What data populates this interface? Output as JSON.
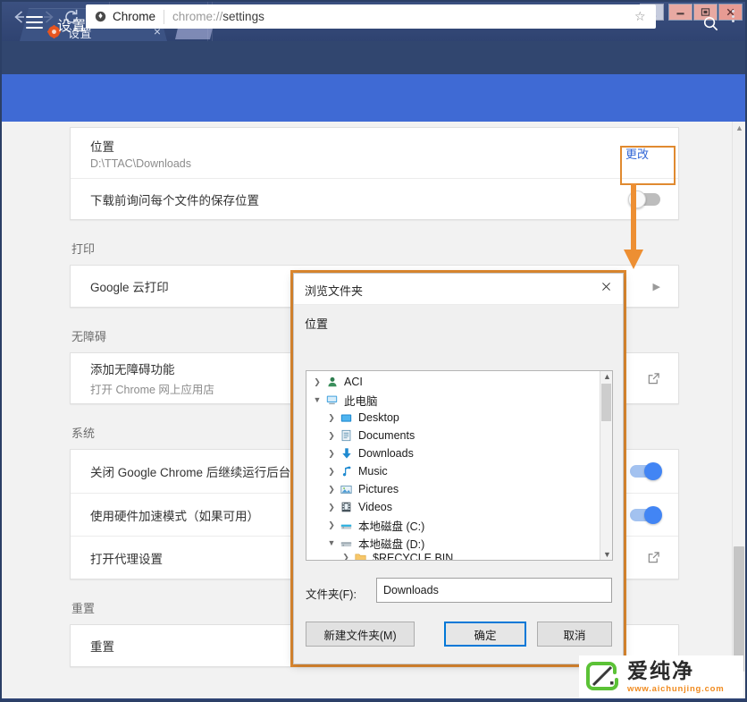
{
  "window": {
    "tab": {
      "title": "设置",
      "icon": "gear-icon",
      "close": "×"
    },
    "controls": {
      "person": "👤",
      "minimize": "—",
      "maximize": "❐",
      "close": "✕"
    }
  },
  "toolbar": {
    "back": "back-arrow-icon",
    "forward": "forward-arrow-icon",
    "reload": "reload-icon",
    "brand": "Chrome",
    "url_prefix": "chrome://",
    "url_page": "settings",
    "star": "☆",
    "menu": "kebab-menu-icon"
  },
  "settings_header": {
    "menu": "hamburger-icon",
    "title": "设置",
    "search": "search-icon"
  },
  "settings": {
    "download_card": {
      "location_label": "位置",
      "location_value": "D:\\TTAC\\Downloads",
      "change_button": "更改",
      "ask_label": "下载前询问每个文件的保存位置",
      "ask_toggle": "off"
    },
    "sections": [
      {
        "label": "打印",
        "rows": [
          {
            "main": "Google 云打印",
            "sub": "",
            "control": "chevron",
            "value": ""
          }
        ]
      },
      {
        "label": "无障碍",
        "rows": [
          {
            "main": "添加无障碍功能",
            "sub": "打开 Chrome 网上应用店",
            "control": "external-link",
            "value": ""
          }
        ]
      },
      {
        "label": "系统",
        "rows": [
          {
            "main": "关闭 Google Chrome 后继续运行后台应",
            "sub": "",
            "control": "toggle",
            "value": "on"
          },
          {
            "main": "使用硬件加速模式（如果可用）",
            "sub": "",
            "control": "toggle",
            "value": "on"
          },
          {
            "main": "打开代理设置",
            "sub": "",
            "control": "external-link",
            "value": ""
          }
        ]
      },
      {
        "label": "重置",
        "rows": [
          {
            "main": "重置",
            "sub": "",
            "control": "none",
            "value": ""
          }
        ]
      }
    ]
  },
  "dialog": {
    "title": "浏览文件夹",
    "close": "✕",
    "location_label": "位置",
    "tree": [
      {
        "label": "ACI",
        "icon": "user-icon",
        "expander": "collapsed",
        "indent": 0
      },
      {
        "label": "此电脑",
        "icon": "computer-icon",
        "expander": "expanded",
        "indent": 0
      },
      {
        "label": "Desktop",
        "icon": "desktop-folder-icon",
        "expander": "collapsed",
        "indent": 1
      },
      {
        "label": "Documents",
        "icon": "documents-folder-icon",
        "expander": "collapsed",
        "indent": 1
      },
      {
        "label": "Downloads",
        "icon": "downloads-folder-icon",
        "expander": "collapsed",
        "indent": 1
      },
      {
        "label": "Music",
        "icon": "music-folder-icon",
        "expander": "collapsed",
        "indent": 1
      },
      {
        "label": "Pictures",
        "icon": "pictures-folder-icon",
        "expander": "collapsed",
        "indent": 1
      },
      {
        "label": "Videos",
        "icon": "videos-folder-icon",
        "expander": "collapsed",
        "indent": 1
      },
      {
        "label": "本地磁盘 (C:)",
        "icon": "system-drive-icon",
        "expander": "collapsed",
        "indent": 1
      },
      {
        "label": "本地磁盘 (D:)",
        "icon": "drive-icon",
        "expander": "expanded",
        "indent": 1
      },
      {
        "label": "$RECYCLE.BIN",
        "icon": "folder-icon",
        "expander": "collapsed",
        "indent": 2
      }
    ],
    "folder_label": "文件夹(F):",
    "folder_value": "Downloads",
    "buttons": {
      "new_folder": "新建文件夹(M)",
      "ok": "确定",
      "cancel": "取消"
    }
  },
  "watermark": {
    "name": "爱纯净",
    "url": "www.aichunjing.com"
  },
  "colors": {
    "accent_blue": "#3f6ad4",
    "highlight_orange": "#e08a30",
    "toggle_on": "#4285f4",
    "link_blue": "#3367d6",
    "watermark_green": "#5bc236",
    "watermark_orange": "#f08a1e"
  }
}
